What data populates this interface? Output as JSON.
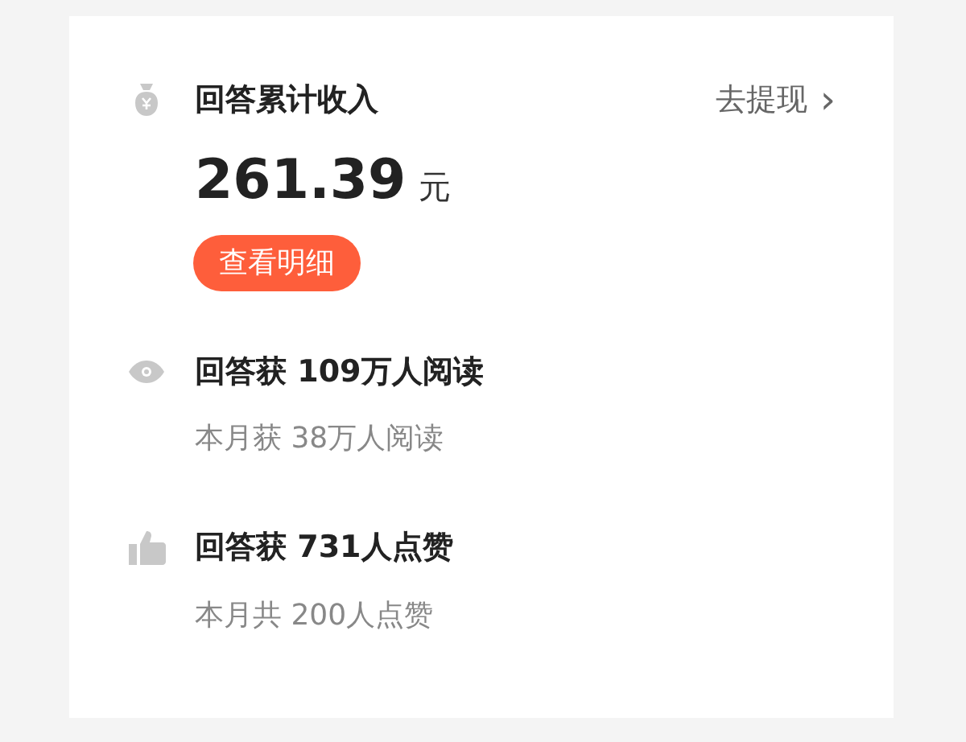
{
  "income": {
    "title": "回答累计收入",
    "withdraw_link": "去提现",
    "withdraw_arrow": "›",
    "amount": "261.39",
    "unit": "元",
    "details_button": "查看明细"
  },
  "stats": [
    {
      "kind": "views",
      "title": "回答获 109万人阅读",
      "subtitle": "本月获 38万人阅读"
    },
    {
      "kind": "likes",
      "title": "回答获 731人点赞",
      "subtitle": "本月共 200人点赞"
    }
  ]
}
